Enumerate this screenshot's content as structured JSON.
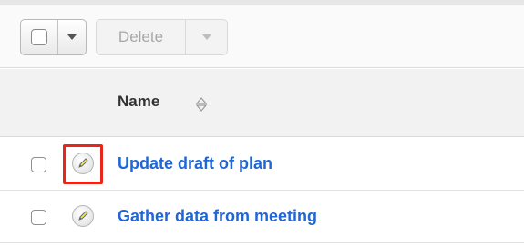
{
  "toolbar": {
    "delete_label": "Delete"
  },
  "table": {
    "columns": [
      {
        "label": "Name",
        "sortable": true
      }
    ],
    "rows": [
      {
        "name": "Update draft of plan",
        "edit_highlighted": true
      },
      {
        "name": "Gather data from meeting",
        "edit_highlighted": false
      }
    ]
  },
  "colors": {
    "link": "#1f66d6",
    "highlight": "#e8261c",
    "header_bg": "#f2f2f2"
  },
  "icons": {
    "select_all": "checkbox-icon",
    "dropdown": "chevron-down-icon",
    "sort": "sort-icon",
    "edit": "pencil-icon"
  }
}
